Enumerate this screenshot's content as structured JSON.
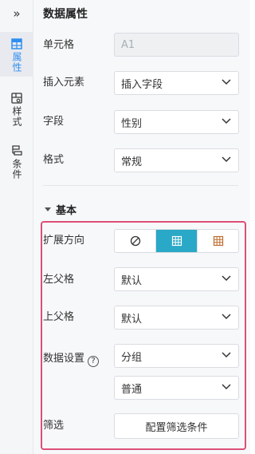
{
  "rail": {
    "collapse_glyph": "»",
    "tabs": [
      {
        "label": "属性",
        "icon": "grid-icon",
        "active": true
      },
      {
        "label": "样式",
        "icon": "style-icon",
        "active": false
      },
      {
        "label": "条件",
        "icon": "condition-icon",
        "active": false
      }
    ]
  },
  "panel": {
    "title": "数据属性",
    "cell": {
      "label": "单元格",
      "value": "A1"
    },
    "insert": {
      "label": "插入元素",
      "value": "插入字段"
    },
    "field": {
      "label": "字段",
      "value": "性别"
    },
    "format": {
      "label": "格式",
      "value": "常规"
    },
    "section_title": "基本",
    "expand": {
      "label": "扩展方向",
      "options": [
        "none-icon",
        "vertical-expand-icon",
        "horizontal-expand-icon"
      ],
      "selected_index": 1
    },
    "left_parent": {
      "label": "左父格",
      "value": "默认"
    },
    "top_parent": {
      "label": "上父格",
      "value": "默认"
    },
    "data_setting": {
      "label": "数据设置",
      "help": "?",
      "value": "分组",
      "value2": "普通"
    },
    "filter": {
      "label": "筛选",
      "button": "配置筛选条件"
    }
  },
  "colors": {
    "accent": "#2aa8c7",
    "highlight": "#dc4f78",
    "active_tab": "#2f8ef0"
  }
}
